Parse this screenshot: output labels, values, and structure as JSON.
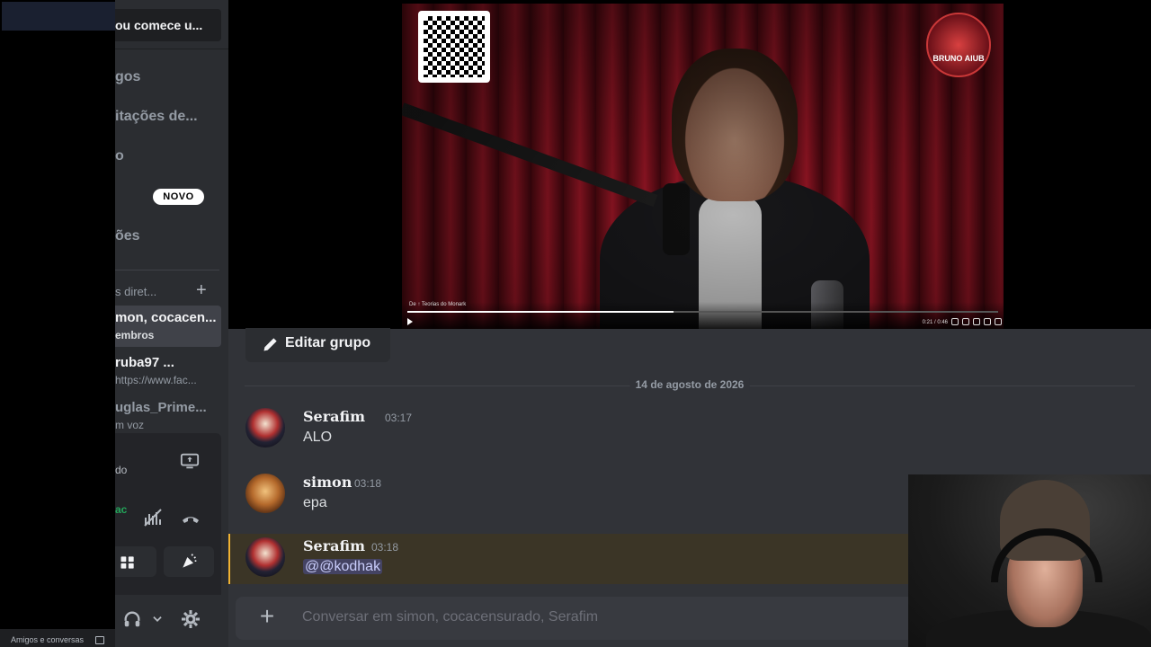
{
  "left_footer": {
    "label": "Amigos e conversas"
  },
  "sidebar": {
    "search_text": "ou comece u...",
    "nav": [
      {
        "label": "gos"
      },
      {
        "label": "itações de..."
      },
      {
        "label": "o"
      },
      {
        "label": ""
      },
      {
        "label": "ões"
      }
    ],
    "new_badge": "NOVO",
    "dm_header": "s diret...",
    "dms": [
      {
        "name": "mon, cocacen...",
        "sub": "embros"
      },
      {
        "name": "ruba97 ...",
        "sub": " https://www.fac..."
      },
      {
        "name": "uglas_Prime...",
        "sub": "m voz"
      }
    ],
    "voice": {
      "status": "do",
      "name": "ac"
    }
  },
  "video": {
    "caption": "De  ↑ Teorias do Monark",
    "time": "0:21 / 0:46",
    "progress_fraction": 0.45,
    "logo_text": "BRUNO AIUB"
  },
  "chat": {
    "edit_group_label": "Editar grupo",
    "date_divider": "14 de agosto de 2026",
    "messages": [
      {
        "author": "Serafim",
        "time": "03:17",
        "text": "ALO",
        "highlight": false
      },
      {
        "author": "simon",
        "time": "03:18",
        "text": "epa",
        "highlight": false
      },
      {
        "author": "Serafim",
        "time": "03:18",
        "text": "@@kodhak",
        "highlight": true
      }
    ],
    "composer_placeholder": "Conversar em simon, cocacensurado, Serafim"
  },
  "colors": {
    "accent": "#5865f2",
    "mention_bar": "#f0b232",
    "online": "#23a55a"
  }
}
